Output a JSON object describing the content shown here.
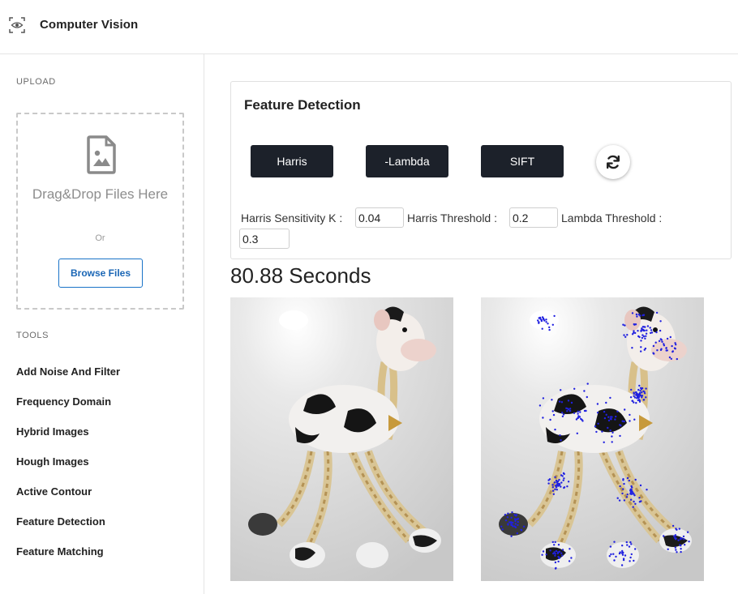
{
  "header": {
    "logo_icon": "eye-scan-icon",
    "title": "Computer Vision"
  },
  "sidebar": {
    "upload_label": "UPLOAD",
    "upload": {
      "icon": "image-file-icon",
      "drag_drop_text": "Drag&Drop Files Here",
      "or_text": "Or",
      "browse_label": "Browse Files"
    },
    "tools_label": "TOOLS",
    "tools": [
      {
        "label": "Add Noise And Filter"
      },
      {
        "label": "Frequency Domain"
      },
      {
        "label": "Hybrid Images"
      },
      {
        "label": "Hough Images"
      },
      {
        "label": "Active Contour"
      },
      {
        "label": "Feature Detection"
      },
      {
        "label": "Feature Matching"
      }
    ]
  },
  "main": {
    "card_title": "Feature Detection",
    "buttons": {
      "harris": "Harris",
      "lambda": "-Lambda",
      "sift": "SIFT",
      "refresh_icon": "refresh-icon"
    },
    "params": {
      "harris_k_label": "Harris Sensitivity K :",
      "harris_k_value": "0.04",
      "harris_threshold_label": "Harris Threshold :",
      "harris_threshold_value": "0.2",
      "lambda_threshold_label": "Lambda Threshold :",
      "lambda_threshold_value": "0.3"
    },
    "timing": "80.88 Seconds"
  },
  "colors": {
    "dark_button": "#1c212a",
    "browse_border": "#1a73c8",
    "keypoint": "#2020e0"
  }
}
